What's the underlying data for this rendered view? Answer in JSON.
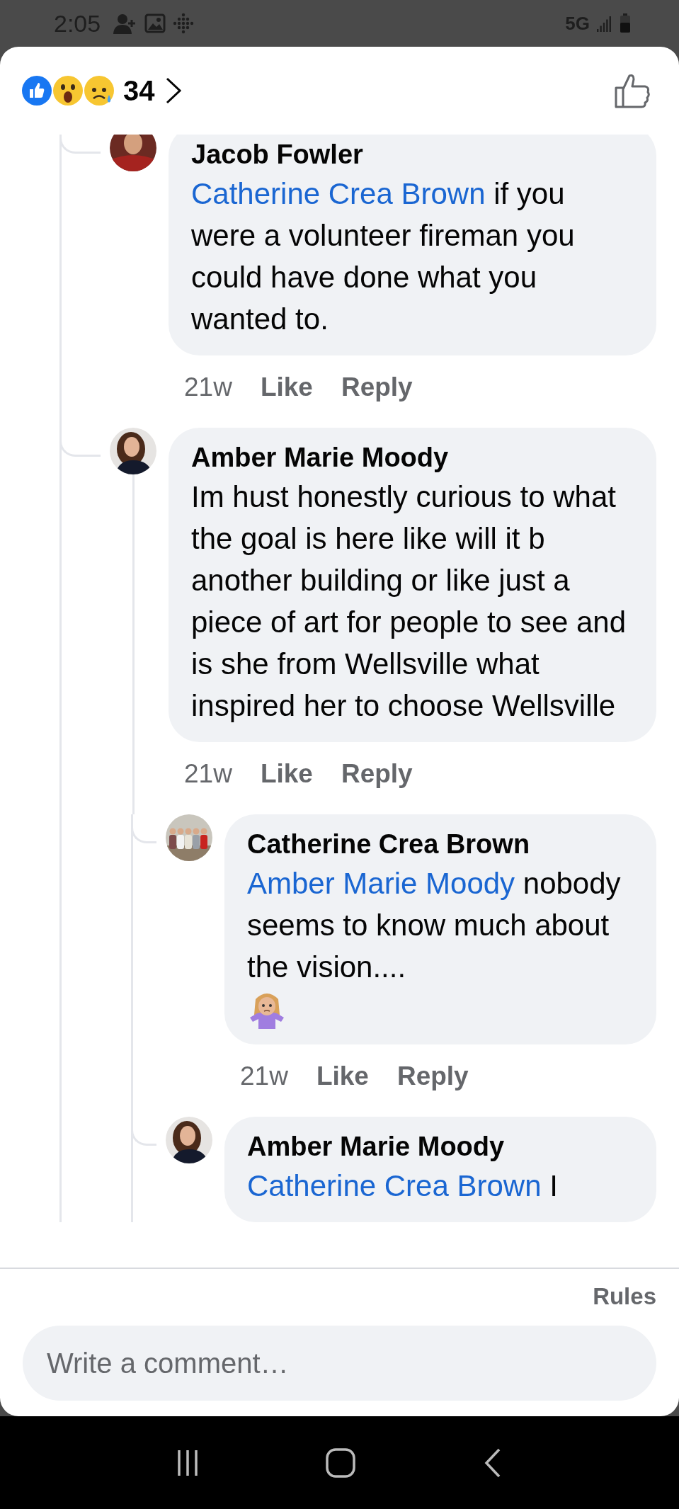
{
  "status_bar": {
    "time": "2:05",
    "network": "5G"
  },
  "reactions": {
    "count": "34"
  },
  "replies": [
    {
      "author": "Jacob Fowler",
      "mention": "Catherine Crea Brown",
      "text": " if you were a volunteer fireman you could have done what you wanted to.",
      "time": "21w",
      "like": "Like",
      "reply": "Reply"
    },
    {
      "author": "Amber Marie Moody",
      "text": "Im hust honestly curious to what the goal is here like will it b another building or like just a piece of art for people to see and is she from Wellsville what inspired her to choose Wellsville",
      "time": "21w",
      "like": "Like",
      "reply": "Reply",
      "children": [
        {
          "author": "Catherine Crea Brown",
          "mention": "Amber Marie Moody",
          "text": " nobody seems to know much about the vision....",
          "shrug_emoji": true,
          "time": "21w",
          "like": "Like",
          "reply": "Reply"
        },
        {
          "author": "Amber Marie Moody",
          "mention": "Catherine Crea Brown",
          "text": " I"
        }
      ]
    }
  ],
  "composer": {
    "rules": "Rules",
    "placeholder": "Write a comment…"
  }
}
